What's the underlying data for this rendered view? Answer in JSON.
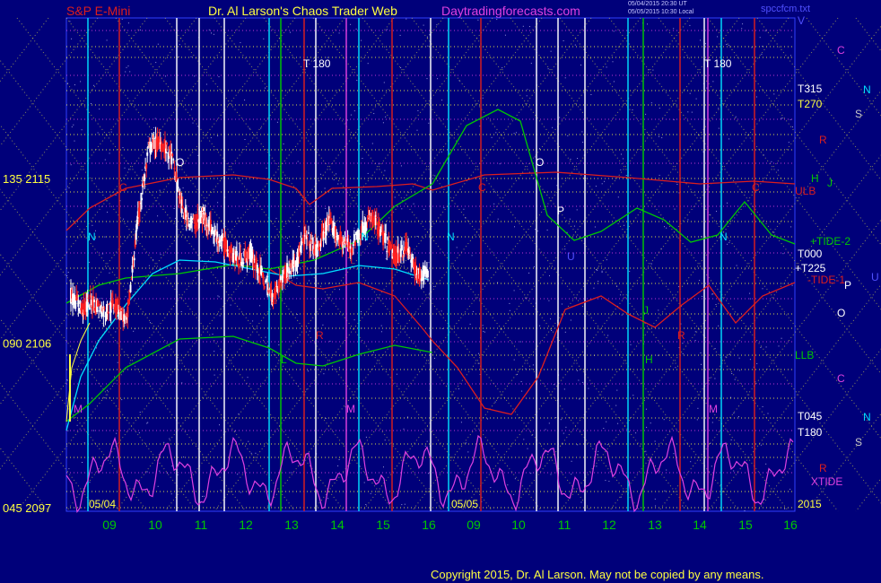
{
  "header": {
    "left": "S&P E-Mini",
    "center": "Dr. Al Larson's Chaos Trader Web",
    "right": "Daytradingforecasts.com",
    "stamp1": "05/04/2015 20:30 UT",
    "stamp2": "05/05/2015 10:30 Local",
    "file": "spccfcm.txt"
  },
  "footer": {
    "copyright": "Copyright 2015, Dr. Al Larson. May not be copied by any means."
  },
  "colors": {
    "background": "#00007a",
    "yellow": "#ffff40",
    "green": "#00c800",
    "red": "#dc1e1e",
    "cyan": "#00e0ff",
    "magenta": "#e040e0",
    "white": "#ffffff",
    "gray": "#c8c8c8"
  },
  "chart_data": {
    "type": "line",
    "title": "S&P E-Mini",
    "x_ticks": [
      "09",
      "10",
      "11",
      "12",
      "13",
      "14",
      "15",
      "16",
      "09",
      "10",
      "11",
      "12",
      "13",
      "14",
      "15",
      "16"
    ],
    "date_labels": [
      "05/04",
      "05/05"
    ],
    "y_ticks": [
      {
        "value": 2115,
        "label": "135  2115"
      },
      {
        "value": 2106,
        "label": "090  2106"
      },
      {
        "value": 2097,
        "label": "045  2097"
      }
    ],
    "ylim": [
      2097,
      2121
    ],
    "right_labels": [
      {
        "text": "V",
        "color": "#5050ff"
      },
      {
        "text": "C",
        "color": "#e040e0"
      },
      {
        "text": "N",
        "color": "#00e0ff"
      },
      {
        "text": "T315",
        "color": "#ffffff"
      },
      {
        "text": "T270",
        "color": "#ffff40"
      },
      {
        "text": "S",
        "color": "#c8c8c8"
      },
      {
        "text": "R",
        "color": "#dc1e1e"
      },
      {
        "text": "H",
        "color": "#00c800"
      },
      {
        "text": "J",
        "color": "#00c800"
      },
      {
        "text": "ULB",
        "color": "#dc1e1e"
      },
      {
        "text": "+TIDE-2",
        "color": "#00c800"
      },
      {
        "text": "T000",
        "color": "#ffffff"
      },
      {
        "text": "+T225",
        "color": "#ffffff"
      },
      {
        "text": "-TIDE-1",
        "color": "#dc1e1e"
      },
      {
        "text": "P",
        "color": "#ffffff"
      },
      {
        "text": "U",
        "color": "#5050ff"
      },
      {
        "text": "O",
        "color": "#ffffff"
      },
      {
        "text": "LLB",
        "color": "#00c800"
      },
      {
        "text": "C",
        "color": "#e040e0"
      },
      {
        "text": "T045",
        "color": "#ffffff"
      },
      {
        "text": "N",
        "color": "#00e0ff"
      },
      {
        "text": "T180",
        "color": "#ffffff"
      },
      {
        "text": "S",
        "color": "#c8c8c8"
      },
      {
        "text": "R",
        "color": "#dc1e1e"
      },
      {
        "text": "XTIDE",
        "color": "#e040e0"
      },
      {
        "text": "2015",
        "color": "#ffff40"
      }
    ],
    "in_chart_labels": [
      {
        "text": "T  180"
      },
      {
        "text": "T  180"
      },
      {
        "text": "C"
      },
      {
        "text": "C"
      },
      {
        "text": "C"
      },
      {
        "text": "O"
      },
      {
        "text": "O"
      },
      {
        "text": "P"
      },
      {
        "text": "P"
      },
      {
        "text": "N"
      },
      {
        "text": "N"
      },
      {
        "text": "N"
      },
      {
        "text": "N"
      },
      {
        "text": "R"
      },
      {
        "text": "R"
      },
      {
        "text": "M"
      },
      {
        "text": "M"
      },
      {
        "text": "M"
      },
      {
        "text": "H"
      },
      {
        "text": "L"
      },
      {
        "text": "J"
      },
      {
        "text": "U"
      }
    ],
    "price_x": [
      0,
      0.25,
      0.5,
      0.75,
      1,
      1.25,
      1.5,
      1.75,
      2,
      2.25,
      2.5,
      2.75,
      3,
      3.25,
      3.5,
      3.75,
      4,
      4.25,
      4.5,
      4.75,
      5,
      5.25,
      5.5,
      5.75,
      6,
      6.25,
      6.5,
      6.75,
      7,
      7.25,
      7.5,
      7.75,
      8
    ],
    "price_close": [
      2108.6,
      2107.9,
      2108.3,
      2107.7,
      2108.2,
      2107.1,
      2112.8,
      2116.7,
      2117.0,
      2116.2,
      2113.2,
      2112.5,
      2112.9,
      2111.8,
      2111.2,
      2110.5,
      2110.9,
      2109.8,
      2108.5,
      2109.7,
      2110.4,
      2111.8,
      2111.0,
      2112.6,
      2111.7,
      2111.2,
      2112.2,
      2112.9,
      2111.7,
      2110.7,
      2111.3,
      2109.6,
      2110.0
    ]
  }
}
